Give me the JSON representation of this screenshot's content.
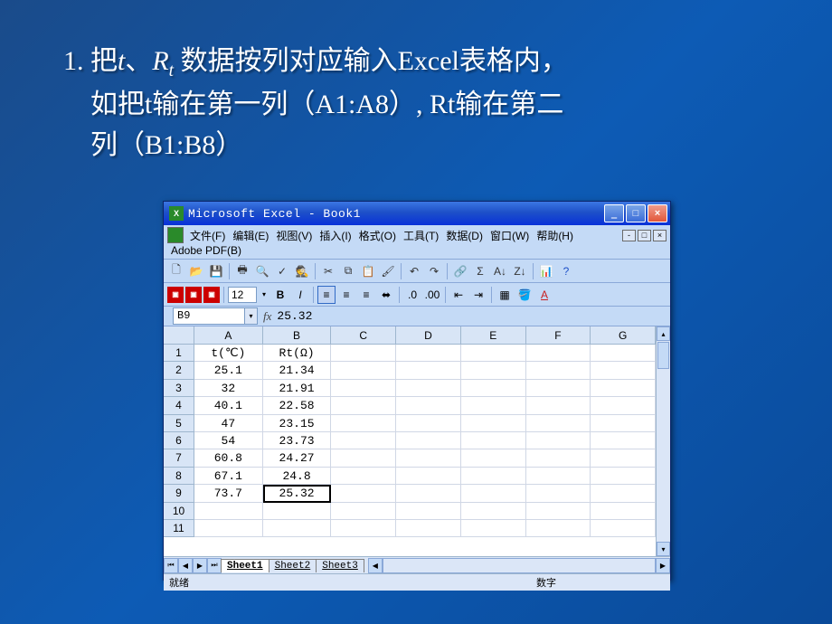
{
  "slide": {
    "line1_prefix": "1. 把",
    "t": "t",
    "sep": "、",
    "R": "R",
    "subt": "t",
    "line1_suffix": " 数据按列对应输入Excel表格内，",
    "line2": "如把t输在第一列（A1:A8）, Rt输在第二",
    "line3": "列（B1:B8）"
  },
  "excel": {
    "title": "Microsoft Excel - Book1",
    "menus": {
      "file": "文件(F)",
      "edit": "编辑(E)",
      "view": "视图(V)",
      "insert": "插入(I)",
      "format": "格式(O)",
      "tools": "工具(T)",
      "data": "数据(D)",
      "window": "窗口(W)",
      "help": "帮助(H)",
      "pdf": "Adobe PDF(B)"
    },
    "fontsize": "12",
    "namebox": "B9",
    "formula": "25.32",
    "col_headers": [
      "A",
      "B",
      "C",
      "D",
      "E",
      "F",
      "G"
    ],
    "row_headers": [
      "1",
      "2",
      "3",
      "4",
      "5",
      "6",
      "7",
      "8",
      "9",
      "10",
      "11"
    ],
    "data": {
      "A": [
        "t(℃)",
        "25.1",
        "32",
        "40.1",
        "47",
        "54",
        "60.8",
        "67.1",
        "73.7",
        "",
        ""
      ],
      "B": [
        "Rt(Ω)",
        "21.34",
        "21.91",
        "22.58",
        "23.15",
        "23.73",
        "24.27",
        "24.8",
        "25.32",
        "",
        ""
      ]
    },
    "selected": {
      "col": "B",
      "row": 9
    },
    "tabs": [
      "Sheet1",
      "Sheet2",
      "Sheet3"
    ],
    "status_left": "就绪",
    "status_right": "数字"
  }
}
